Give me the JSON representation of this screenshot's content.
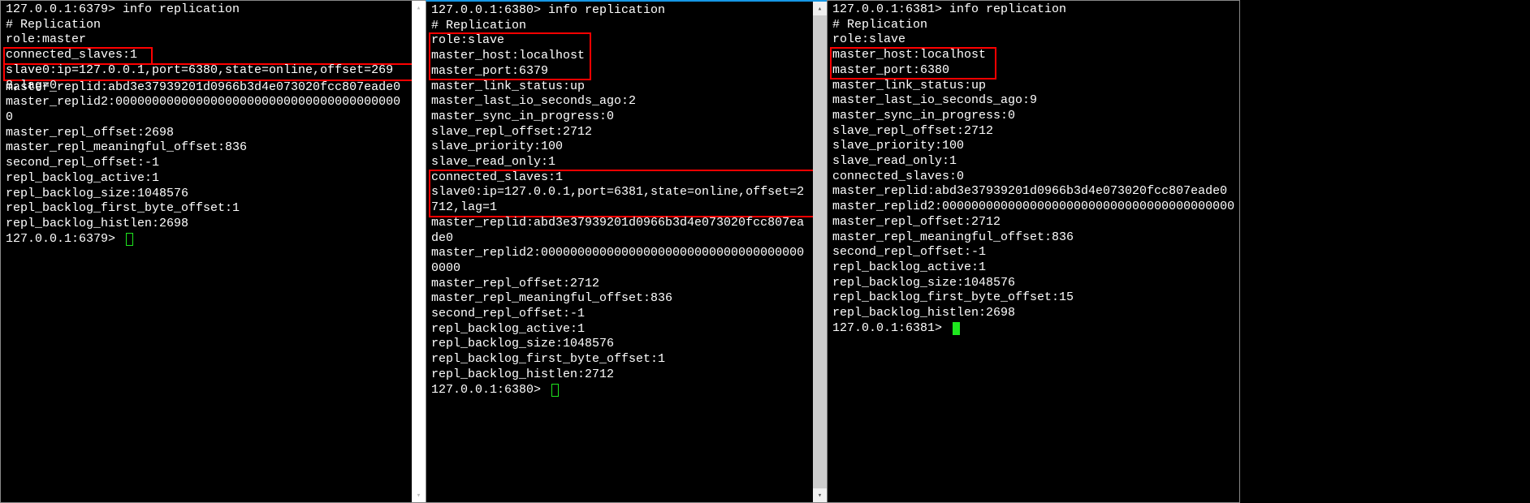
{
  "pane1": {
    "prompt": "127.0.0.1:6379> info replication",
    "lines": [
      "# Replication",
      "role:master"
    ],
    "hlLine1": "connected_slaves:1",
    "hlLine2": "slave0:ip=127.0.0.1,port=6380,state=online,offset=2698,lag=0",
    "tail": [
      "master_replid:abd3e37939201d0966b3d4e073020fcc807eade0",
      "master_replid2:0000000000000000000000000000000000000000",
      "master_repl_offset:2698",
      "master_repl_meaningful_offset:836",
      "second_repl_offset:-1",
      "repl_backlog_active:1",
      "repl_backlog_size:1048576",
      "repl_backlog_first_byte_offset:1",
      "repl_backlog_histlen:2698"
    ],
    "endPrompt": "127.0.0.1:6379> "
  },
  "pane2": {
    "prompt": "127.0.0.1:6380> info replication",
    "line1": "# Replication",
    "hlBlock1": [
      "role:slave",
      "master_host:localhost",
      "master_port:6379"
    ],
    "mid": [
      "master_link_status:up",
      "master_last_io_seconds_ago:2",
      "master_sync_in_progress:0",
      "slave_repl_offset:2712",
      "slave_priority:100",
      "slave_read_only:1"
    ],
    "hlBlock2": [
      "connected_slaves:1",
      "slave0:ip=127.0.0.1,port=6381,state=online,offset=2712,lag=1"
    ],
    "tail": [
      "master_replid:abd3e37939201d0966b3d4e073020fcc807eade0",
      "master_replid2:0000000000000000000000000000000000000000",
      "master_repl_offset:2712",
      "master_repl_meaningful_offset:836",
      "second_repl_offset:-1",
      "repl_backlog_active:1",
      "repl_backlog_size:1048576",
      "repl_backlog_first_byte_offset:1",
      "repl_backlog_histlen:2712"
    ],
    "endPrompt": "127.0.0.1:6380> "
  },
  "pane3": {
    "prompt": "127.0.0.1:6381> info replication",
    "lines": [
      "# Replication",
      "role:slave"
    ],
    "hlBlock": [
      "master_host:localhost",
      "master_port:6380"
    ],
    "tail": [
      "master_link_status:up",
      "master_last_io_seconds_ago:9",
      "master_sync_in_progress:0",
      "slave_repl_offset:2712",
      "slave_priority:100",
      "slave_read_only:1",
      "connected_slaves:0",
      "master_replid:abd3e37939201d0966b3d4e073020fcc807eade0",
      "master_replid2:0000000000000000000000000000000000000000",
      "master_repl_offset:2712",
      "master_repl_meaningful_offset:836",
      "second_repl_offset:-1",
      "repl_backlog_active:1",
      "repl_backlog_size:1048576",
      "repl_backlog_first_byte_offset:15",
      "repl_backlog_histlen:2698"
    ],
    "endPrompt": "127.0.0.1:6381> "
  }
}
